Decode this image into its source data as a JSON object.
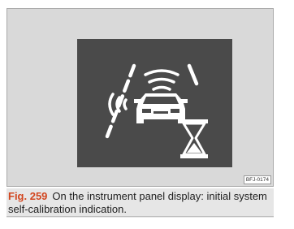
{
  "figure": {
    "label": "Fig. 259",
    "caption_text": "On the instrument panel display: initial system self-calibration indication.",
    "code": "BFJ-0174",
    "icon": "front-assist-calibration-icon",
    "colors": {
      "frame_bg": "#d9d9d9",
      "panel_bg": "#4a4a4a",
      "icon": "#ffffff",
      "label_accent": "#d2451e"
    }
  }
}
